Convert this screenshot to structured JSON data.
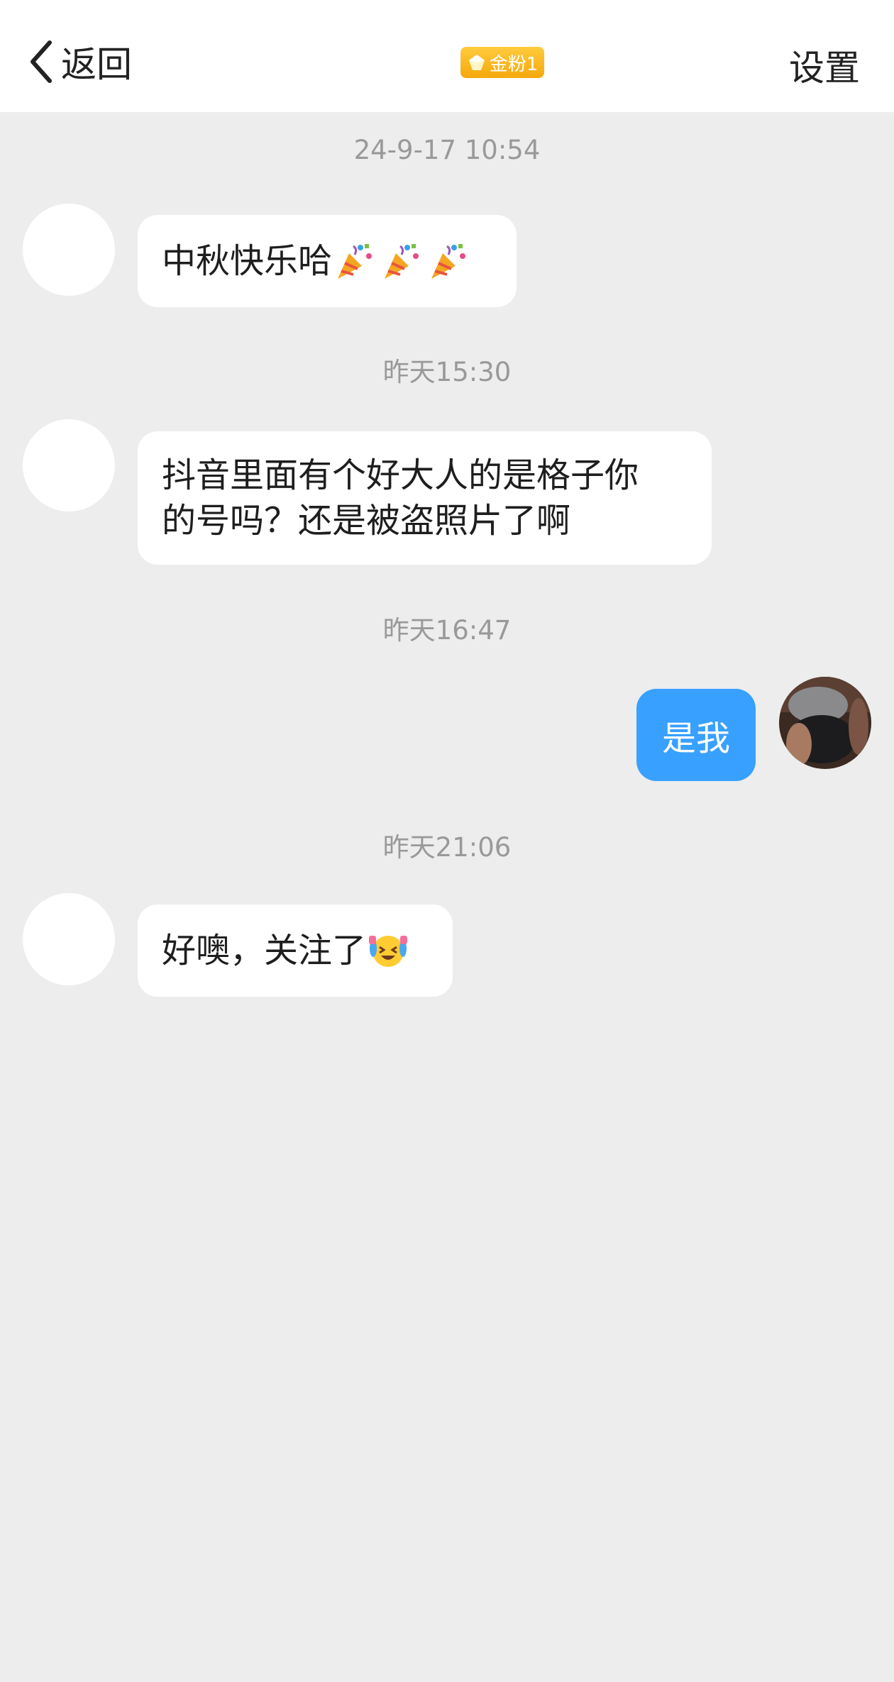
{
  "header": {
    "back_label": "返回",
    "badge_label": "金粉1",
    "settings_label": "设置"
  },
  "messages": [
    {
      "timestamp": "24-9-17 10:54",
      "sender": "other",
      "text": "中秋快乐哈",
      "emoji": [
        "party-popper",
        "party-popper",
        "party-popper"
      ]
    },
    {
      "timestamp": "昨天15:30",
      "sender": "other",
      "lines": [
        "抖音里面有个好大人的是格子你",
        "的号吗？还是被盗照片了啊"
      ]
    },
    {
      "timestamp": "昨天16:47",
      "sender": "me",
      "text": "是我"
    },
    {
      "timestamp": "昨天21:06",
      "sender": "other",
      "text": "好噢，关注了",
      "emoji": [
        "crying-laughing-face"
      ]
    }
  ],
  "colors": {
    "background": "#ededed",
    "header_bg": "#ffffff",
    "my_bubble": "#38a0ff",
    "their_bubble": "#ffffff",
    "badge": "#f5a80c",
    "timestamp": "#999999"
  }
}
